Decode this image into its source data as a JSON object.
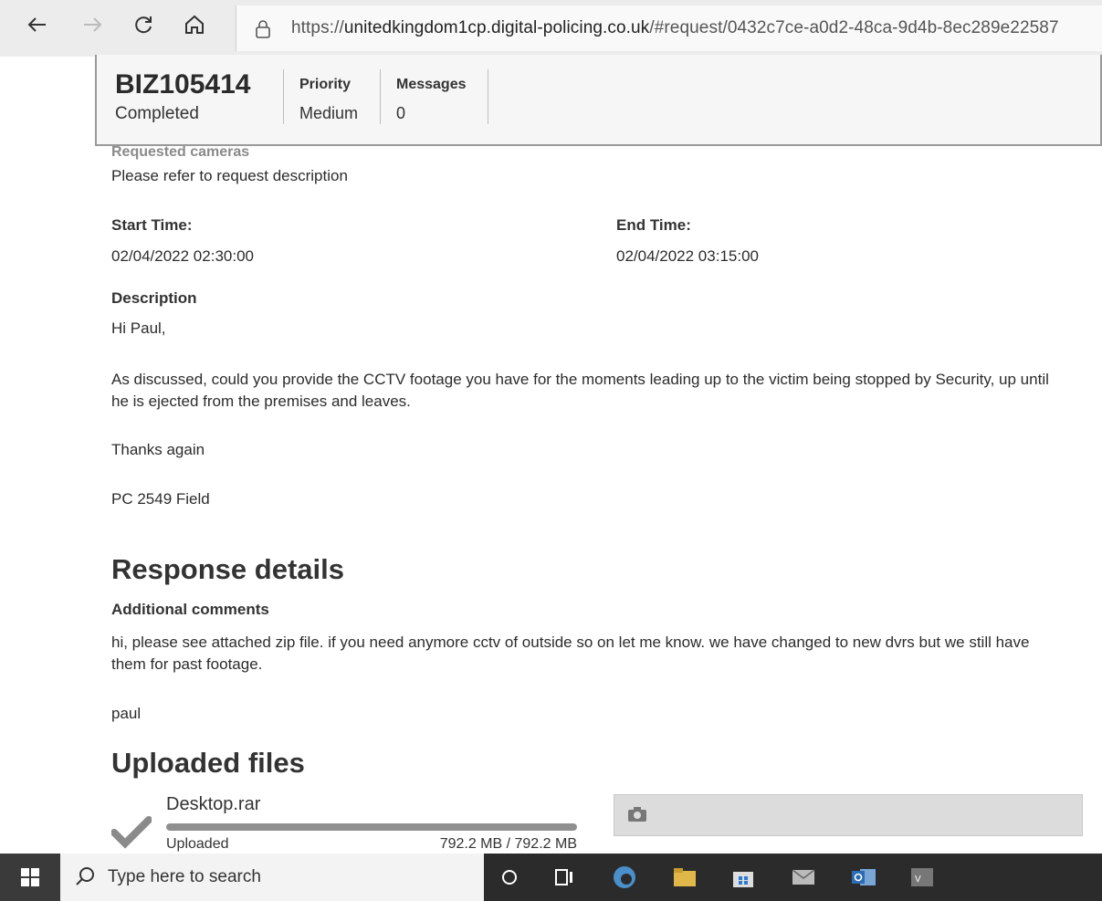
{
  "browser": {
    "url_prefix": "https://",
    "url_domain": "unitedkingdom1cp.digital-policing.co.uk",
    "url_rest": "/#request/0432c7ce-a0d2-48ca-9d4b-8ec289e22587",
    "icons": [
      "back-arrow-icon",
      "forward-arrow-icon",
      "reload-icon",
      "home-icon",
      "lock-icon"
    ]
  },
  "request": {
    "id": "BIZ105414",
    "status": "Completed",
    "priority_label": "Priority",
    "priority_value": "Medium",
    "messages_label": "Messages",
    "messages_value": "0"
  },
  "details": {
    "cameras_label": "Requested cameras",
    "cameras_value": "Please refer to request description",
    "start_label": "Start Time:",
    "start_value": "02/04/2022 02:30:00",
    "end_label": "End Time:",
    "end_value": "02/04/2022 03:15:00",
    "description_label": "Description",
    "description_lines": [
      "Hi Paul,",
      "As discussed, could you provide the CCTV footage you have for the moments leading up to the victim being stopped by Security, up until he is ejected from the premises and leaves.",
      "Thanks again",
      "PC 2549 Field"
    ]
  },
  "response": {
    "heading": "Response details",
    "comments_label": "Additional comments",
    "comments_lines": [
      "hi, please see attached zip file. if you need anymore cctv of outside so on let me know. we have changed to new dvrs but we still have them for past footage.",
      "paul"
    ]
  },
  "uploads": {
    "heading": "Uploaded files",
    "file_name": "Desktop.rar",
    "file_status": "Uploaded",
    "file_size": "792.2 MB / 792.2 MB",
    "progress": 1.0,
    "icons": [
      "checkmark-icon",
      "camera-icon"
    ]
  },
  "taskbar": {
    "search_placeholder": "Type here to search",
    "icons": [
      "windows-start-icon",
      "search-icon",
      "cortana-icon",
      "task-view-icon",
      "edge-icon",
      "file-explorer-icon",
      "store-icon",
      "mail-icon",
      "outlook-icon",
      "app-icon"
    ]
  },
  "colors": {
    "taskbar_bg": "#2b2b2b",
    "header_bg": "#f6f6f6",
    "progress_fill": "#8f8f8f"
  }
}
